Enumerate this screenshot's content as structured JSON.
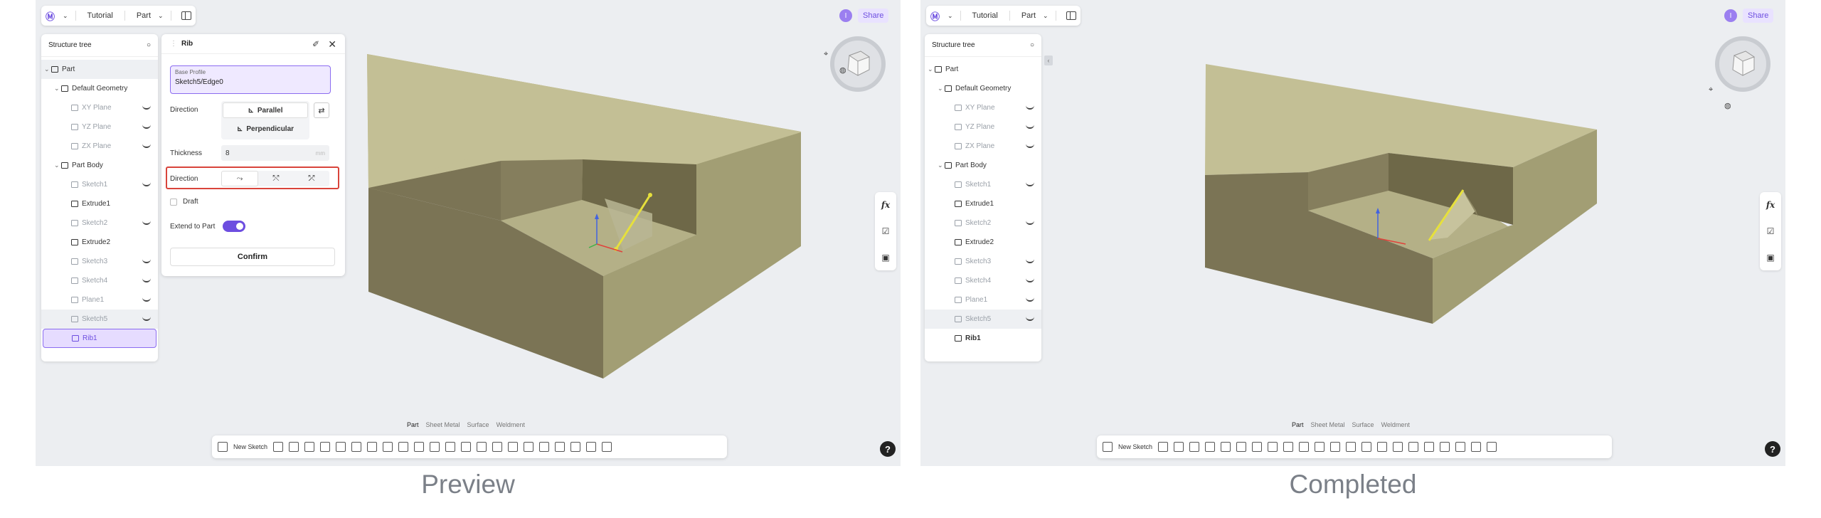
{
  "captions": {
    "left": "Preview",
    "right": "Completed"
  },
  "topbar": {
    "logo": "Ⓜ",
    "project": "Tutorial",
    "mode": "Part"
  },
  "share": {
    "user_initial": "I",
    "button": "Share"
  },
  "structure_tree": {
    "title": "Structure tree",
    "items": [
      {
        "label": "Part",
        "level": 0
      },
      {
        "label": "Default Geometry",
        "level": 1
      },
      {
        "label": "XY Plane",
        "level": 2
      },
      {
        "label": "YZ Plane",
        "level": 2
      },
      {
        "label": "ZX Plane",
        "level": 2
      },
      {
        "label": "Part Body",
        "level": 1
      },
      {
        "label": "Sketch1",
        "level": 2
      },
      {
        "label": "Extrude1",
        "level": 2
      },
      {
        "label": "Sketch2",
        "level": 2
      },
      {
        "label": "Extrude2",
        "level": 2
      },
      {
        "label": "Sketch3",
        "level": 2
      },
      {
        "label": "Sketch4",
        "level": 2
      },
      {
        "label": "Plane1",
        "level": 2
      },
      {
        "label": "Sketch5",
        "level": 2
      },
      {
        "label": "Rib1",
        "level": 2
      }
    ]
  },
  "rib_panel": {
    "title": "Rib",
    "base_profile_label": "Base Profile",
    "base_profile_value": "Sketch5/Edge0",
    "direction_label": "Direction",
    "parallel": "Parallel",
    "perpendicular": "Perpendicular",
    "thickness_label": "Thickness",
    "thickness_value": "8",
    "thickness_unit": "mm",
    "direction2_label": "Direction",
    "draft_label": "Draft",
    "extend_label": "Extend to Part",
    "extend_on": true,
    "confirm": "Confirm"
  },
  "bottom_tabs": [
    "Part",
    "Sheet Metal",
    "Surface",
    "Weldment"
  ],
  "toolbar": {
    "new_sketch": "New Sketch"
  },
  "right_panel": {
    "fx": "fx"
  },
  "help": "?",
  "colors": {
    "accent": "#6d4ee0",
    "highlight": "#d9443b",
    "solid_top": "#c3bf95",
    "solid_front": "#7b7455",
    "solid_side": "#a29e74"
  }
}
